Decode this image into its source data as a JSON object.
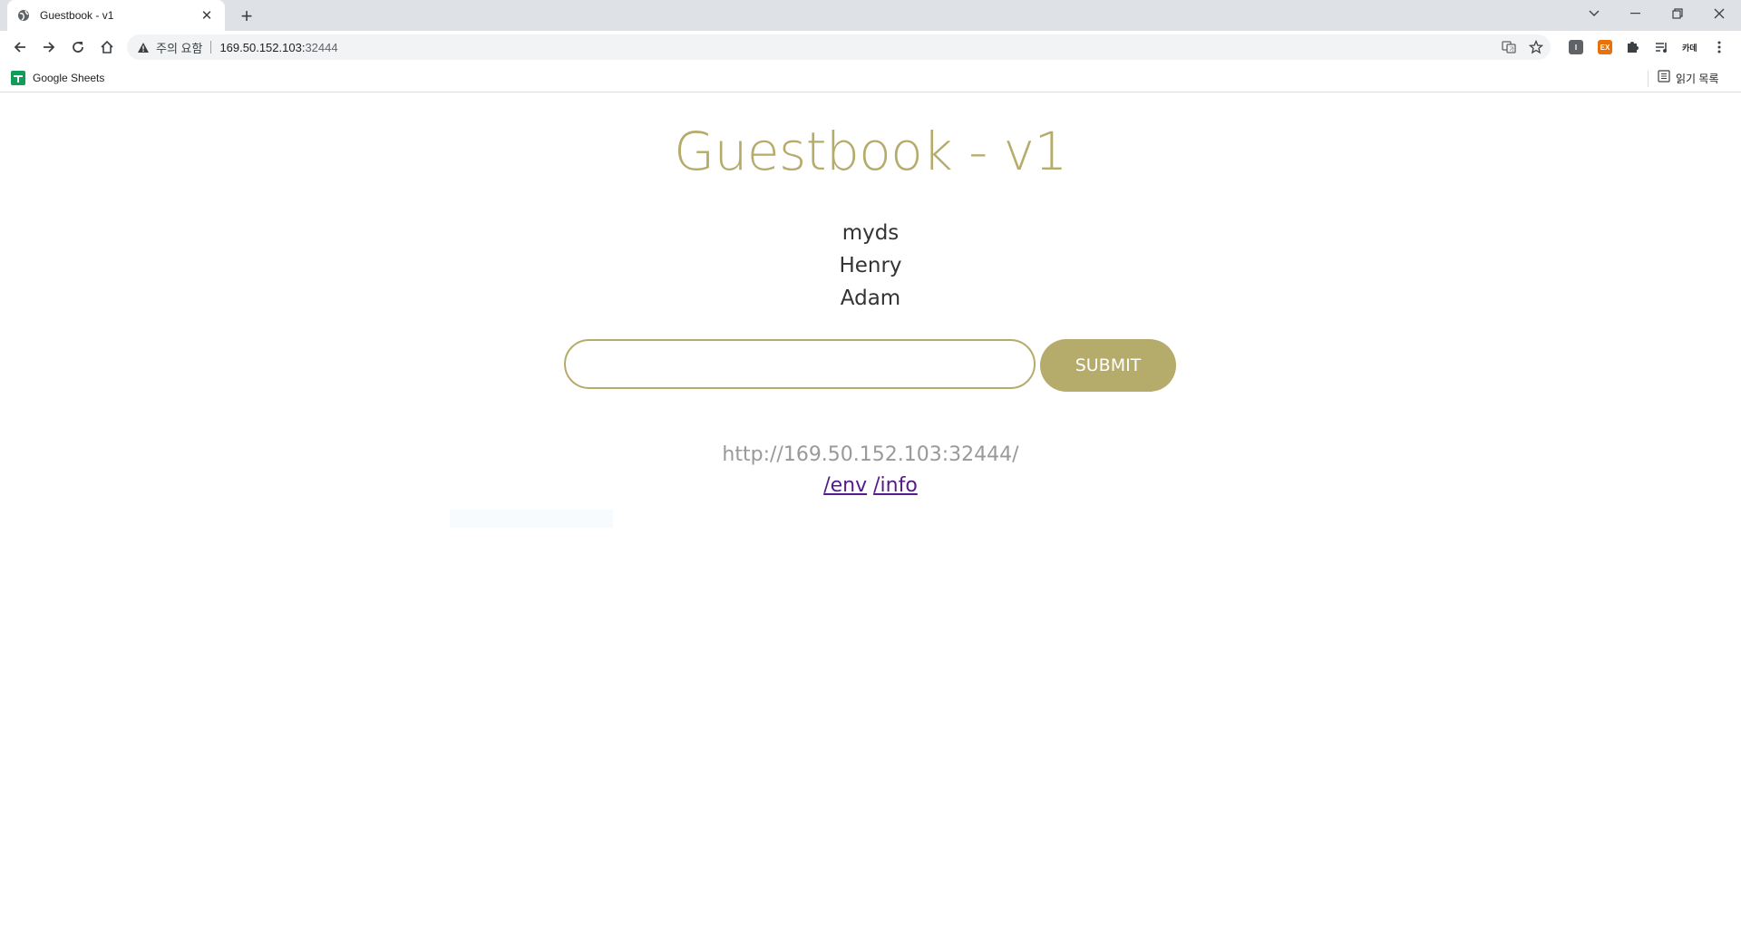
{
  "browser": {
    "tab": {
      "title": "Guestbook - v1",
      "favicon": "globe-icon"
    },
    "omnibox": {
      "security_label": "주의 요함",
      "url_host": "169.50.152.103:",
      "url_port": "32444"
    },
    "bookmarks": [
      {
        "label": "Google Sheets",
        "icon": "google-sheets-icon"
      }
    ],
    "reading_list_label": "읽기 목록"
  },
  "page": {
    "title": "Guestbook - v1",
    "entries": [
      "myds",
      "Henry",
      "Adam"
    ],
    "input": {
      "value": "",
      "placeholder": ""
    },
    "submit_label": "SUBMIT",
    "host_address": "http://169.50.152.103:32444/",
    "links": [
      {
        "label": "/env"
      },
      {
        "label": "/info"
      }
    ],
    "colors": {
      "accent": "#b5ab6b",
      "link": "#551a8b",
      "host_text": "#999999"
    }
  }
}
